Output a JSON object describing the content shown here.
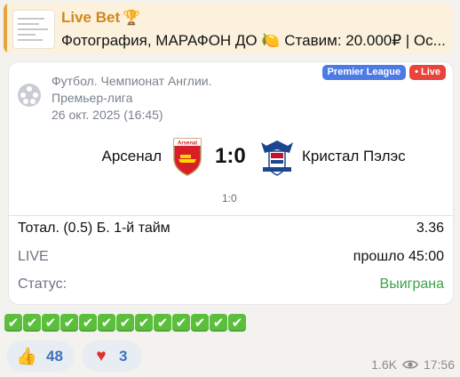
{
  "reply": {
    "title": "Live Bet",
    "title_icon": "trophy-icon",
    "snippet": "Фотография, МАРАФОН ДО 🍋 Ставим: 20.000₽ | Ос..."
  },
  "match": {
    "league_line1": "Футбол. Чемпионат Англии.",
    "league_line2": "Премьер-лига",
    "datetime": "26 окт. 2025 (16:45)",
    "badge_league": "Premier League",
    "badge_live": "Live",
    "home_team": "Арсенал",
    "away_team": "Кристал Пэлэс",
    "home_crest_text": "Arsenal",
    "score": "1:0",
    "sub_score": "1:0"
  },
  "bet": {
    "market": "Тотал. (0.5) Б. 1-й тайм",
    "odds": "3.36",
    "status_label_live": "LIVE",
    "elapsed": "прошло 45:00",
    "status_label": "Статус:",
    "status_value": "Выиграна"
  },
  "checks": [
    "✔",
    "✔",
    "✔",
    "✔",
    "✔",
    "✔",
    "✔",
    "✔",
    "✔",
    "✔",
    "✔",
    "✔",
    "✔"
  ],
  "reactions": {
    "like_icon": "thumbs-up",
    "like_count": "48",
    "heart_icon": "heart",
    "heart_count": "3"
  },
  "footer": {
    "views": "1.6K",
    "time": "17:56"
  },
  "colors": {
    "accent": "#d0871b",
    "win": "#3aa44a",
    "badge_league": "#4d7be6",
    "badge_live": "#e9443b"
  }
}
